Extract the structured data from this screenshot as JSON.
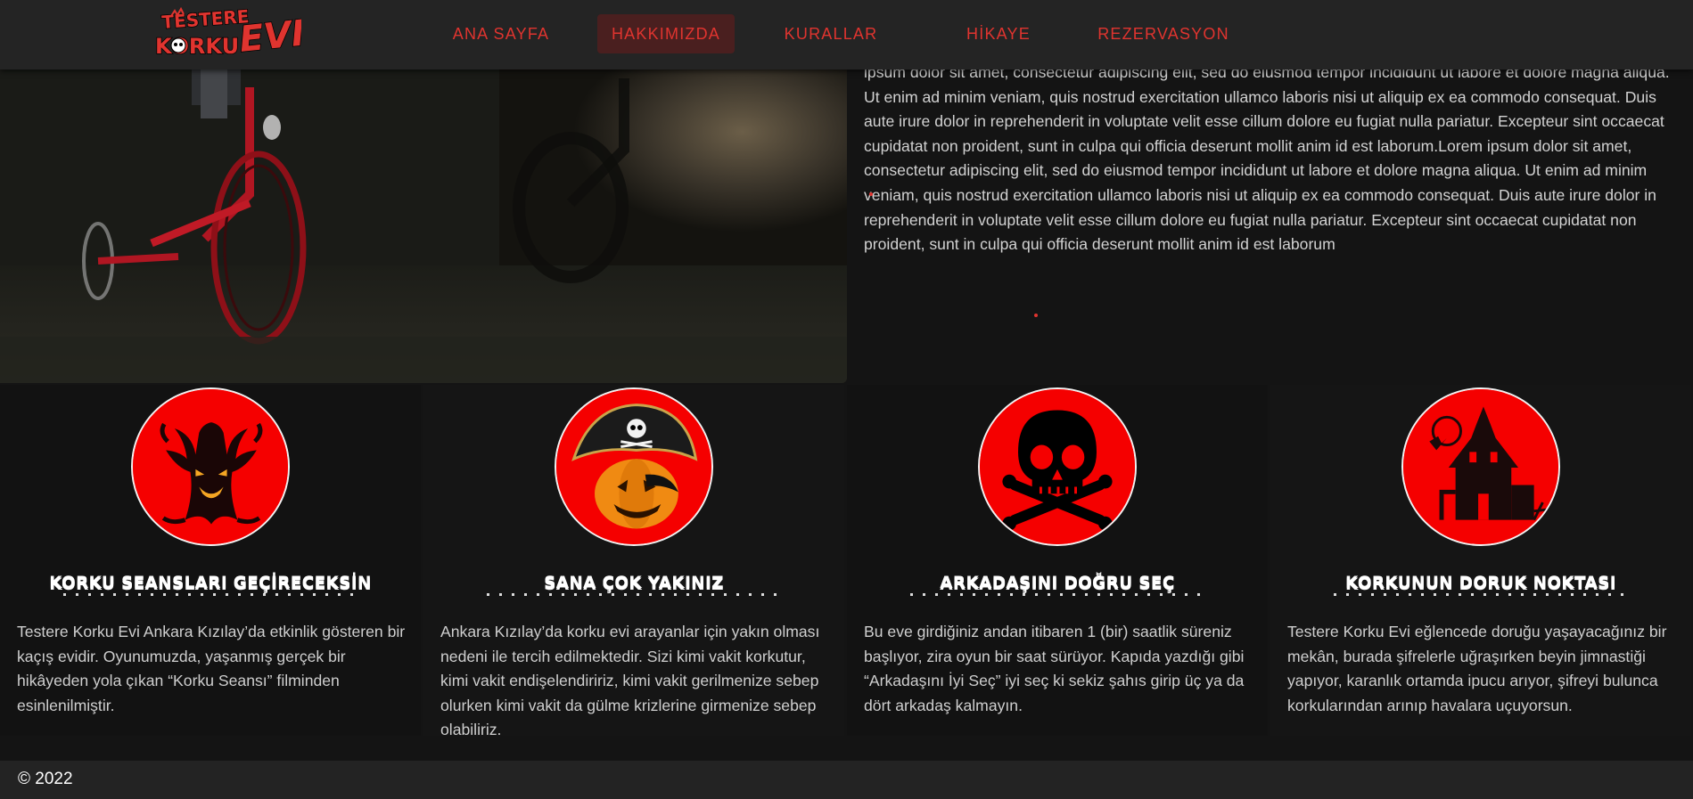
{
  "header": {
    "logo_text_line1": "TESTERE",
    "logo_text_line2": "KORKU",
    "logo_text_evi": "EVI",
    "nav": [
      {
        "label": "ANA SAYFA",
        "active": false
      },
      {
        "label": "HAKKIMIZDA",
        "active": true
      },
      {
        "label": "KURALLAR",
        "active": false
      },
      {
        "label": "HİKAYE",
        "active": false
      },
      {
        "label": "REZERVASYON",
        "active": false
      }
    ]
  },
  "hero": {
    "image": "tricycle-dark-scene",
    "lorem": "ipsum dolor sit amet, consectetur adipiscing elit, sed do eiusmod tempor incididunt ut labore et dolore magna aliqua. Ut enim ad minim veniam, quis nostrud exercitation ullamco laboris nisi ut aliquip ex ea commodo consequat. Duis aute irure dolor in reprehenderit in voluptate velit esse cillum dolore eu fugiat nulla pariatur. Excepteur sint occaecat cupidatat non proident, sunt in culpa qui officia deserunt mollit anim id est laborum.Lorem ipsum dolor sit amet, consectetur adipiscing elit, sed do eiusmod tempor incididunt ut labore et dolore magna aliqua. Ut enim ad minim veniam, quis nostrud exercitation ullamco laboris nisi ut aliquip ex ea commodo consequat. Duis aute irure dolor in reprehenderit in voluptate velit esse cillum dolore eu fugiat nulla pariatur. Excepteur sint occaecat cupidatat non proident, sunt in culpa qui officia deserunt mollit anim id est laborum"
  },
  "features": [
    {
      "icon": "haunted-tree-icon",
      "title": "KORKU SEANSLARI GEÇİRECEKSİN",
      "text": "Testere Korku Evi Ankara Kızılay’da etkinlik gösteren bir kaçış evidir. Oyunumuzda, yaşanmış gerçek bir hikâyeden yola çıkan “Korku Seansı” filminden esinlenilmiştir."
    },
    {
      "icon": "pirate-pumpkin-icon",
      "title": "SANA ÇOK YAKINIZ",
      "text": "Ankara Kızılay’da korku evi arayanlar için yakın olması nedeni ile tercih edilmektedir. Sizi kimi vakit korkutur, kimi vakit endişelendiririz, kimi vakit gerilmenize sebep olurken kimi vakit da gülme krizlerine girmenize sebep olabiliriz."
    },
    {
      "icon": "skull-crossbones-icon",
      "title": "ARKADAŞINI DOĞRU SEÇ",
      "text": "Bu eve girdiğiniz andan itibaren 1 (bir) saatlik süreniz başlıyor, zira oyun bir saat sürüyor. Kapıda yazdığı gibi “Arkadaşını İyi Seç” iyi seç ki sekiz şahıs girip üç ya da dört arkadaş kalmayın."
    },
    {
      "icon": "haunted-house-icon",
      "title": "KORKUNUN DORUK NOKTASI",
      "text": "Testere Korku Evi eğlencede doruğu yaşayacağınız bir mekân, burada şifrelerle uğraşırken beyin jimnastiği yapıyor, karanlık ortamda ipucu arıyor, şifreyi bulunca korkularından arınıp havalara uçuyorsun."
    }
  ],
  "footer": {
    "copyright": "© 2022"
  },
  "colors": {
    "accent": "#e0342f",
    "badge": "#f50000",
    "nav_bg": "#242424",
    "page_bg": "#141414"
  }
}
